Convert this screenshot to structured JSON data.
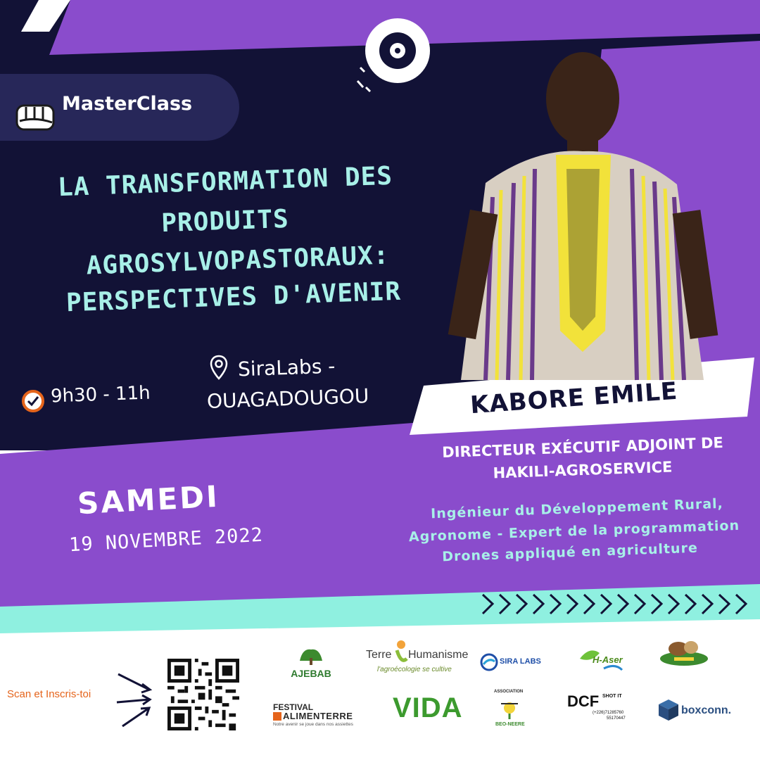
{
  "badge": {
    "label": "MasterClass",
    "icon": "fist-icon"
  },
  "title": {
    "lines": [
      "LA TRANSFORMATION DES",
      "PRODUITS",
      "AGROSYLVOPASTORAUX:",
      "PERSPECTIVES D'AVENIR"
    ]
  },
  "schedule": {
    "time": "9h30 - 11h",
    "icon": "clock-icon"
  },
  "location": {
    "line1": "SiraLabs -",
    "line2": "OUAGADOUGOU",
    "icon": "location-pin-icon"
  },
  "speaker": {
    "name": "KABORE EMILE",
    "role_line1": "DIRECTEUR EXÉCUTIF ADJOINT DE",
    "role_line2": "HAKILI-AGROSERVICE",
    "bio_line1": "Ingénieur du Développement Rural,",
    "bio_line2": "Agronome - Expert de la programmation",
    "bio_line3": "Drones appliqué en agriculture"
  },
  "event_date": {
    "day": "SAMEDI",
    "date": "19 NOVEMBRE 2022"
  },
  "registration": {
    "cta": "Scan et Inscris-toi"
  },
  "partners": {
    "ajebab": "AJEBAB",
    "terre_a": "Terre",
    "terre_b": "Humanisme",
    "terre_tag": "l'agroécologie se cultive",
    "sira": "SIRA LABS",
    "haser": "H-Aser",
    "festival_a": "FESTIVAL",
    "festival_b": "ALIMENTERRE",
    "festival_tag": "Notre avenir se joue dans nos assiettes",
    "vida": "VIDA",
    "beo_a": "ASSOCIATION",
    "beo_b": "BEO-NEERE",
    "dcf_a": "DCF",
    "dcf_b": "SHOT IT",
    "dcf_phone": "(+226)71285760",
    "dcf_phone2": "55170447",
    "boxconn": "boxconn."
  },
  "colors": {
    "navy": "#121236",
    "purple": "#8a4ccc",
    "purple_light": "#9055d6",
    "mint": "#8ff0e0",
    "title": "#a8f0e8",
    "orange": "#e5641b"
  }
}
